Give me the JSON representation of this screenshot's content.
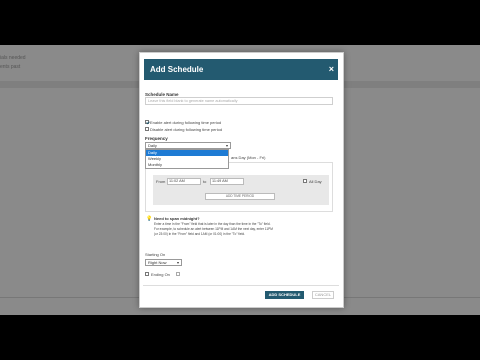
{
  "background": {
    "line1": "ials needed",
    "line2": "ents past"
  },
  "modal": {
    "title": "Add Schedule",
    "close": "×",
    "schedule_name_label": "Schedule Name",
    "schedule_name_placeholder": "Leave this field blank to generate name automatically",
    "enable_option": "Enable alert during following time period",
    "disable_option": "Disable alert during following time period",
    "frequency_label": "Frequency",
    "frequency_value": "Daily",
    "frequency_options": [
      "Daily",
      "Weekly",
      "Monthly"
    ],
    "timezone_hint": "ans Day (Mon - Fri)",
    "from_label": "From",
    "from_time": "11:02 AM",
    "to_label": "to",
    "to_time": "11:49 AM",
    "all_day_label": "All Day",
    "add_period": "ADD TIME PERIOD",
    "overnight_title": "Need to span midnight?",
    "overnight_line1": "Enter a time in the \"From\" field that is later in the day than the time in the \"To\" field.",
    "overnight_line2": "For example, to schedule an alert between 11PM and 1AM the next day, enter 11PM",
    "overnight_line3": "(or 23:00) in the \"From\" field and 1AM (or 01:00) in the \"To\" field.",
    "starting_on_label": "Starting On",
    "starting_on_value": "Right Now",
    "ending_on_label": "Ending On",
    "add_button": "ADD SCHEDULE",
    "cancel_button": "CANCEL"
  },
  "colors": {
    "header": "#235a70",
    "highlight": "#1e7bd4"
  }
}
